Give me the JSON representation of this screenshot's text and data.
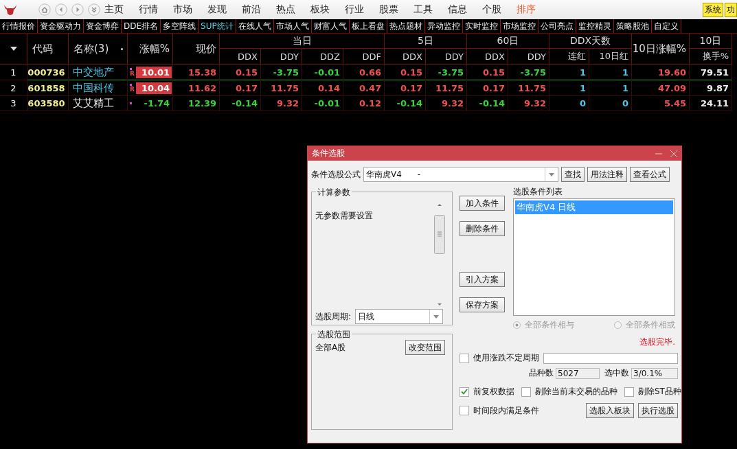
{
  "app_bar": {
    "menu": [
      {
        "label": "主页",
        "selected": false
      },
      {
        "label": "行情",
        "selected": false
      },
      {
        "label": "市场",
        "selected": false
      },
      {
        "label": "发现",
        "selected": false
      },
      {
        "label": "前沿",
        "selected": false
      },
      {
        "label": "热点",
        "selected": false
      },
      {
        "label": "板块",
        "selected": false
      },
      {
        "label": "行业",
        "selected": false
      },
      {
        "label": "股票",
        "selected": false
      },
      {
        "label": "工具",
        "selected": false
      },
      {
        "label": "信息",
        "selected": false
      },
      {
        "label": "个股",
        "selected": false
      },
      {
        "label": "排序",
        "selected": true
      }
    ],
    "right_buttons": [
      "系统",
      "功"
    ]
  },
  "tabs": [
    {
      "label": "行情报价",
      "selected": false
    },
    {
      "label": "资金驱动力",
      "selected": false
    },
    {
      "label": "资金博弈",
      "selected": false
    },
    {
      "label": "DDE排名",
      "selected": false
    },
    {
      "label": "多空阵线",
      "selected": false
    },
    {
      "label": "SUP统计",
      "selected": true
    },
    {
      "label": "在线人气",
      "selected": false
    },
    {
      "label": "市场人气",
      "selected": false
    },
    {
      "label": "财富人气",
      "selected": false
    },
    {
      "label": "板上看盘",
      "selected": false
    },
    {
      "label": "热点题材",
      "selected": false
    },
    {
      "label": "异动监控",
      "selected": false
    },
    {
      "label": "实时监控",
      "selected": false
    },
    {
      "label": "市场监控",
      "selected": false
    },
    {
      "label": "公司亮点",
      "selected": false
    },
    {
      "label": "监控精灵",
      "selected": false
    },
    {
      "label": "策略股池",
      "selected": false
    },
    {
      "label": "自定义",
      "selected": false
    }
  ],
  "table": {
    "columns": [
      {
        "kind": "sort"
      },
      {
        "label": "代码"
      },
      {
        "label": "名称(3)"
      },
      {
        "label": "涨幅%"
      },
      {
        "label": "现价"
      },
      {
        "label": "DDX",
        "group": "当日"
      },
      {
        "label": "DDY",
        "in_group": true
      },
      {
        "label": "DDZ",
        "in_group": true
      },
      {
        "label": "DDF",
        "in_group": true
      },
      {
        "label": "DDX",
        "group": "5日"
      },
      {
        "label": "DDY",
        "in_group": true
      },
      {
        "label": "DDX",
        "group": "60日"
      },
      {
        "label": "DDY",
        "in_group": true
      },
      {
        "label": "连红",
        "group": "DDX天数"
      },
      {
        "label": "10日红",
        "in_group": true
      },
      {
        "label": "10日涨幅%"
      },
      {
        "label": "换手%",
        "group": "10日"
      }
    ],
    "rows": [
      {
        "selected": true,
        "cells": [
          {
            "text": "1"
          },
          {
            "text": "000736"
          },
          {
            "text": "中交地产",
            "marked": true
          },
          {
            "text": "10.01",
            "flag": "R",
            "limit_up": true
          },
          {
            "text": "15.38",
            "kind": "rise"
          },
          {
            "text": "0.15",
            "kind": "rise"
          },
          {
            "text": "-3.75",
            "kind": "fall"
          },
          {
            "text": "-0.01",
            "kind": "fall"
          },
          {
            "text": "0.66",
            "kind": "rise"
          },
          {
            "text": "0.15",
            "kind": "rise"
          },
          {
            "text": "-3.75",
            "kind": "fall"
          },
          {
            "text": "0.15",
            "kind": "rise"
          },
          {
            "text": "-3.75",
            "kind": "fall"
          },
          {
            "text": "1",
            "kind": "count"
          },
          {
            "text": "1",
            "kind": "count"
          },
          {
            "text": "19.60",
            "kind": "rise"
          },
          {
            "text": "79.51",
            "kind": "plain"
          }
        ]
      },
      {
        "selected": false,
        "cells": [
          {
            "text": "2"
          },
          {
            "text": "601858"
          },
          {
            "text": "中国科传",
            "marked": true
          },
          {
            "text": "10.04",
            "flag": "R",
            "limit_up": true
          },
          {
            "text": "11.62",
            "kind": "rise"
          },
          {
            "text": "0.17",
            "kind": "rise"
          },
          {
            "text": "11.75",
            "kind": "rise"
          },
          {
            "text": "0.14",
            "kind": "rise"
          },
          {
            "text": "0.47",
            "kind": "rise"
          },
          {
            "text": "0.17",
            "kind": "rise"
          },
          {
            "text": "11.75",
            "kind": "rise"
          },
          {
            "text": "0.17",
            "kind": "rise"
          },
          {
            "text": "11.75",
            "kind": "rise"
          },
          {
            "text": "1",
            "kind": "count"
          },
          {
            "text": "1",
            "kind": "count"
          },
          {
            "text": "47.09",
            "kind": "rise"
          },
          {
            "text": "9.87",
            "kind": "plain"
          }
        ]
      },
      {
        "selected": false,
        "cells": [
          {
            "text": "3"
          },
          {
            "text": "603580"
          },
          {
            "text": "艾艾精工",
            "marked": false
          },
          {
            "text": "-1.74",
            "kind": "fall",
            "limit_up": false
          },
          {
            "text": "12.39",
            "kind": "fall"
          },
          {
            "text": "-0.14",
            "kind": "fall"
          },
          {
            "text": "9.32",
            "kind": "rise"
          },
          {
            "text": "-0.01",
            "kind": "fall"
          },
          {
            "text": "0.12",
            "kind": "rise"
          },
          {
            "text": "-0.14",
            "kind": "fall"
          },
          {
            "text": "9.32",
            "kind": "rise"
          },
          {
            "text": "-0.14",
            "kind": "fall"
          },
          {
            "text": "9.32",
            "kind": "rise"
          },
          {
            "text": "0",
            "kind": "count"
          },
          {
            "text": "0",
            "kind": "count"
          },
          {
            "text": "5.45",
            "kind": "rise"
          },
          {
            "text": "24.11",
            "kind": "plain"
          }
        ]
      }
    ]
  },
  "dialog": {
    "title": "条件选股",
    "formula": {
      "label": "条件选股公式",
      "value": "华南虎V4      -"
    },
    "top_buttons": [
      "查找",
      "用法注释",
      "查看公式"
    ],
    "params": {
      "legend": "计算参数",
      "text": "无参数需要设置"
    },
    "period": {
      "label": "选股周期:",
      "value": "日线"
    },
    "scope": {
      "legend": "选股范围",
      "text": "全部A股",
      "button": "改变范围"
    },
    "side_buttons": [
      "加入条件",
      "删除条件",
      "引入方案",
      "保存方案"
    ],
    "list": {
      "label": "选股条件列表",
      "items": [
        {
          "label": "华南虎V4  日线",
          "selected": true
        }
      ]
    },
    "logic": [
      {
        "label": "全部条件相与",
        "selected": true
      },
      {
        "label": "全部条件相或",
        "selected": false
      }
    ],
    "logic_disabled": true,
    "status": "选股完毕.",
    "variable_period": {
      "label": "使用涨跌不定周期",
      "checked": false
    },
    "counts": [
      {
        "label": "品种数",
        "value": "5027"
      },
      {
        "label": "选中数",
        "value": "3/0.1%"
      }
    ],
    "options": [
      {
        "label": "前复权数据",
        "checked": true
      },
      {
        "label": "剔除当前未交易的品种",
        "checked": false
      },
      {
        "label": "剔除ST品种",
        "checked": false
      }
    ],
    "time_option": {
      "label": "时间段内满足条件",
      "checked": false
    },
    "bottom_buttons": [
      "选股入板块",
      "执行选股"
    ]
  }
}
